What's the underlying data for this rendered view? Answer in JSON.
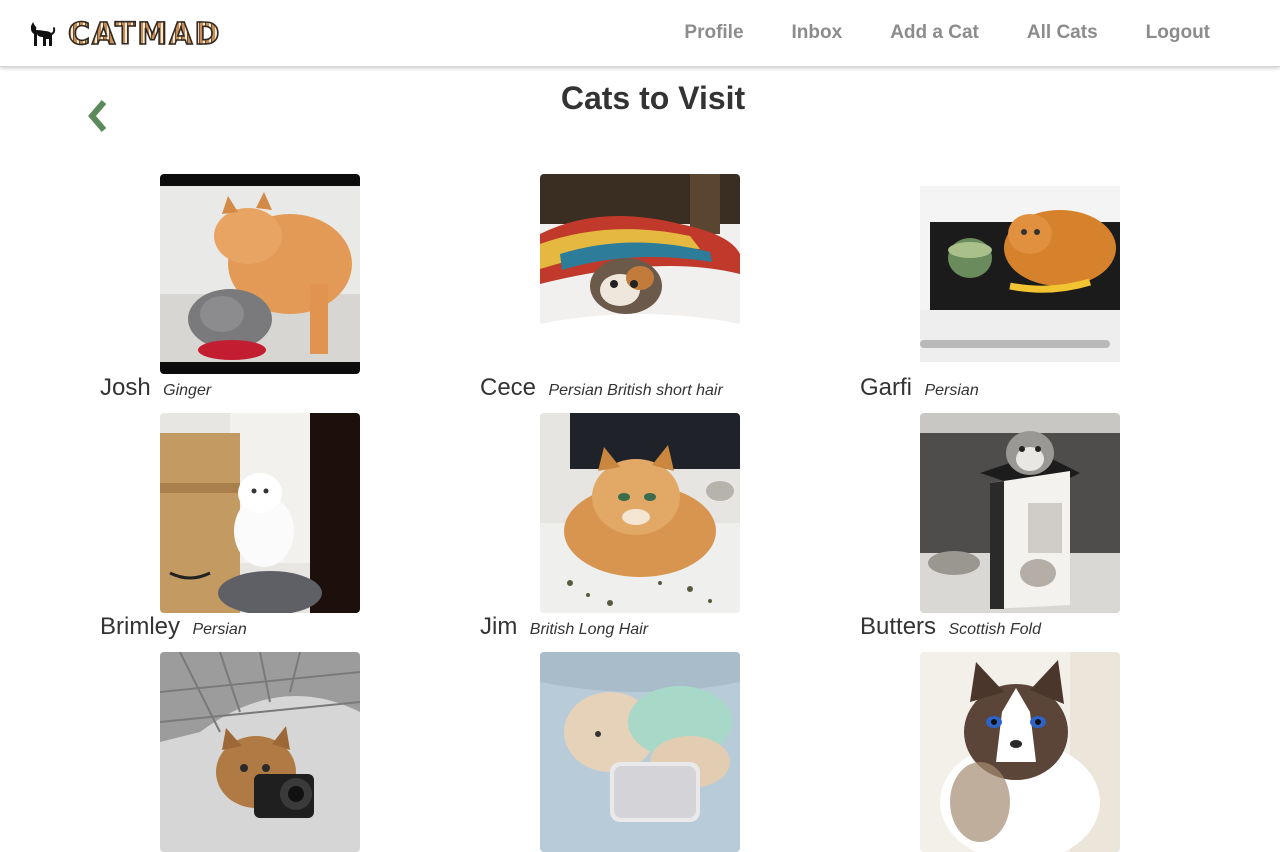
{
  "brand": {
    "name": "CATMAD",
    "logo_icon": "cat-icon"
  },
  "nav": {
    "items": [
      {
        "label": "Profile"
      },
      {
        "label": "Inbox"
      },
      {
        "label": "Add a Cat"
      },
      {
        "label": "All Cats"
      },
      {
        "label": "Logout"
      }
    ]
  },
  "page": {
    "title": "Cats to Visit",
    "back_icon": "chevron-left-icon",
    "accent": "#5d8a5a"
  },
  "cats": [
    {
      "name": "Josh",
      "breed": "Ginger"
    },
    {
      "name": "Cece",
      "breed": "Persian British short hair"
    },
    {
      "name": "Garfi",
      "breed": "Persian"
    },
    {
      "name": "Brimley",
      "breed": "Persian"
    },
    {
      "name": "Jim",
      "breed": "British Long Hair"
    },
    {
      "name": "Butters",
      "breed": "Scottish Fold"
    },
    {
      "name": "",
      "breed": ""
    },
    {
      "name": "",
      "breed": ""
    },
    {
      "name": "",
      "breed": ""
    }
  ]
}
